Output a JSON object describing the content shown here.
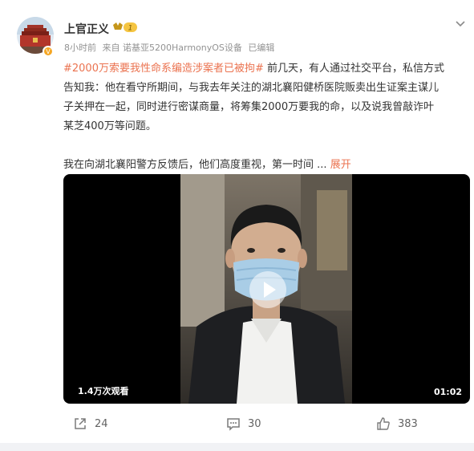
{
  "post": {
    "author": "上官正义",
    "level": "1",
    "time": "8小时前",
    "source": "来自 诺基亚5200HarmonyOS设备",
    "edited": "已编辑",
    "hashtag": "#2000万索要我性命系编造涉案者已被拘#",
    "line1_rest": " 前几天，有人通过社交平台，私信方式",
    "line2": "告知我：他在看守所期间，与我去年关注的湖北襄阳健桥医院贩卖出生证案主谋儿",
    "line3": "子关押在一起，同时进行密谋商量，将筹集2000万要我的命，以及说我曾敲诈叶",
    "line4": "某芝400万等问题。",
    "line5": "我在向湖北襄阳警方反馈后，他们高度重视，第一时间 ",
    "ellipsis": "...",
    "expand": "展开"
  },
  "video": {
    "views": "1.4万次观看",
    "duration": "01:02"
  },
  "actions": {
    "share_count": "24",
    "comment_count": "30",
    "like_count": "383"
  },
  "colors": {
    "accent": "#eb7350",
    "text": "#333333",
    "meta": "#939393"
  },
  "icons": [
    "share-icon",
    "comment-icon",
    "like-icon",
    "chevron-down-icon",
    "play-icon",
    "verified-badge-icon",
    "level-icon"
  ]
}
